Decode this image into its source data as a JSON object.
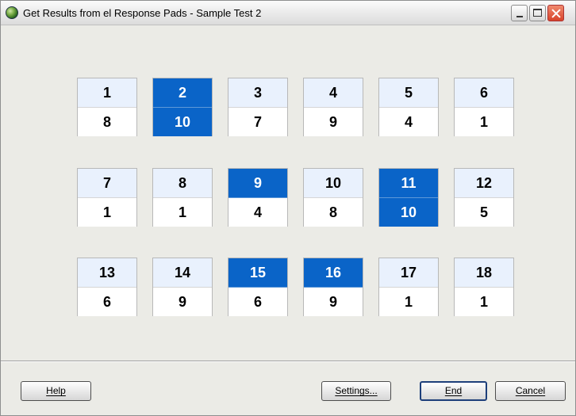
{
  "window": {
    "title": "Get Results from el Response Pads - Sample Test 2"
  },
  "pads": [
    {
      "number": "1",
      "value": "8",
      "number_highlighted": false,
      "value_highlighted": false
    },
    {
      "number": "2",
      "value": "10",
      "number_highlighted": true,
      "value_highlighted": true
    },
    {
      "number": "3",
      "value": "7",
      "number_highlighted": false,
      "value_highlighted": false
    },
    {
      "number": "4",
      "value": "9",
      "number_highlighted": false,
      "value_highlighted": false
    },
    {
      "number": "5",
      "value": "4",
      "number_highlighted": false,
      "value_highlighted": false
    },
    {
      "number": "6",
      "value": "1",
      "number_highlighted": false,
      "value_highlighted": false
    },
    {
      "number": "7",
      "value": "1",
      "number_highlighted": false,
      "value_highlighted": false
    },
    {
      "number": "8",
      "value": "1",
      "number_highlighted": false,
      "value_highlighted": false
    },
    {
      "number": "9",
      "value": "4",
      "number_highlighted": true,
      "value_highlighted": false
    },
    {
      "number": "10",
      "value": "8",
      "number_highlighted": false,
      "value_highlighted": false
    },
    {
      "number": "11",
      "value": "10",
      "number_highlighted": true,
      "value_highlighted": true
    },
    {
      "number": "12",
      "value": "5",
      "number_highlighted": false,
      "value_highlighted": false
    },
    {
      "number": "13",
      "value": "6",
      "number_highlighted": false,
      "value_highlighted": false
    },
    {
      "number": "14",
      "value": "9",
      "number_highlighted": false,
      "value_highlighted": false
    },
    {
      "number": "15",
      "value": "6",
      "number_highlighted": true,
      "value_highlighted": false
    },
    {
      "number": "16",
      "value": "9",
      "number_highlighted": true,
      "value_highlighted": false
    },
    {
      "number": "17",
      "value": "1",
      "number_highlighted": false,
      "value_highlighted": false
    },
    {
      "number": "18",
      "value": "1",
      "number_highlighted": false,
      "value_highlighted": false
    }
  ],
  "buttons": {
    "help": "Help",
    "settings": "Settings...",
    "end": "End",
    "cancel": "Cancel"
  },
  "colors": {
    "highlight": "#0a64c8",
    "pad_number_bg": "#e9f1fd",
    "window_bg": "#ebebe6"
  },
  "icons": {
    "app": "green-globe-icon",
    "minimize": "minimize-icon",
    "maximize": "maximize-icon",
    "close": "close-icon"
  }
}
